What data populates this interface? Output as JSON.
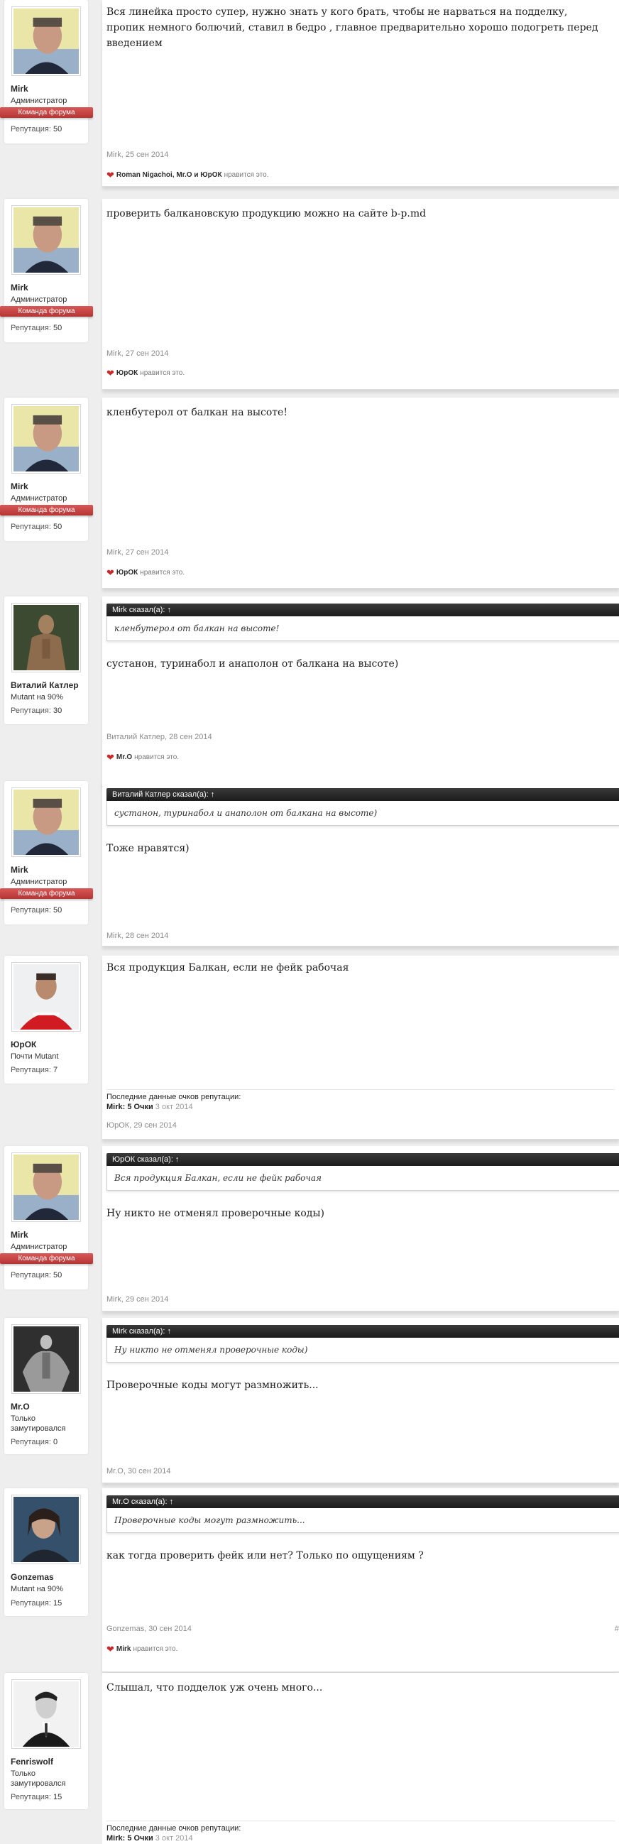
{
  "posts": [
    {
      "user": {
        "name": "Mirk",
        "title": "Администратор",
        "ribbon": "Команда форума",
        "rep_label": "Репутация:",
        "rep_value": "50",
        "avatar": "avatar-mirk"
      },
      "text": "Вся линейка просто супер, нужно знать у кого брать, чтобы не нарваться на подделку, пропик немного болючий, ставил в бедро , главное предварительно хорошо подогреть перед введением",
      "meta": "Mirk, 25 сен 2014",
      "likes": {
        "names": "Roman Nigachoi, Mr.O и ЮрОК",
        "suffix": "нравится это."
      }
    },
    {
      "user": {
        "name": "Mirk",
        "title": "Администратор",
        "ribbon": "Команда форума",
        "rep_label": "Репутация:",
        "rep_value": "50",
        "avatar": "avatar-mirk"
      },
      "text": "проверить балкановскую продукцию можно на сайте b-p.md",
      "meta": "Mirk, 27 сен 2014",
      "likes": {
        "names": "ЮрОК",
        "suffix": "нравится это."
      }
    },
    {
      "user": {
        "name": "Mirk",
        "title": "Администратор",
        "ribbon": "Команда форума",
        "rep_label": "Репутация:",
        "rep_value": "50",
        "avatar": "avatar-mirk"
      },
      "text": "кленбутерол от балкан на высоте!",
      "meta": "Mirk, 27 сен 2014",
      "likes": {
        "names": "ЮрОК",
        "suffix": "нравится это."
      }
    },
    {
      "user": {
        "name": "Виталий Катлер",
        "title": "Mutant на 90%",
        "rep_label": "Репутация:",
        "rep_value": "30",
        "avatar": "avatar-vitaly"
      },
      "quote": {
        "head": "Mirk сказал(а): ↑",
        "body": "кленбутерол от балкан на высоте!"
      },
      "text": "сустанон, туринабол и анаполон от балкана на высоте)",
      "meta": "Виталий Катлер, 28 сен 2014",
      "likes": {
        "names": "Mr.O",
        "suffix": "нравится это."
      }
    },
    {
      "user": {
        "name": "Mirk",
        "title": "Администратор",
        "ribbon": "Команда форума",
        "rep_label": "Репутация:",
        "rep_value": "50",
        "avatar": "avatar-mirk"
      },
      "quote": {
        "head": "Виталий Катлер сказал(а): ↑",
        "body": "сустанон, туринабол и анаполон от балкана на высоте)"
      },
      "text": "Тоже нравятся)",
      "meta": "Mirk, 28 сен 2014"
    },
    {
      "user": {
        "name": "ЮрОК",
        "title": "Почти Mutant",
        "rep_label": "Репутация:",
        "rep_value": "7",
        "avatar": "avatar-yurok"
      },
      "text": "Вся продукция Балкан, если не фейк рабочая",
      "last_rep": {
        "label": "Последние данные очков репутации:",
        "who": "Mirk:",
        "pts": "5 Очки",
        "date": "3 окт 2014"
      },
      "meta": "ЮрОК, 29 сен 2014"
    },
    {
      "user": {
        "name": "Mirk",
        "title": "Администратор",
        "ribbon": "Команда форума",
        "rep_label": "Репутация:",
        "rep_value": "50",
        "avatar": "avatar-mirk"
      },
      "quote": {
        "head": "ЮрОК сказал(а): ↑",
        "body": "Вся продукция Балкан, если не фейк рабочая"
      },
      "text": "Ну никто не отменял проверочные коды)",
      "meta": "Mirk, 29 сен 2014"
    },
    {
      "user": {
        "name": "Mr.O",
        "title": "Только замутировался",
        "rep_label": "Репутация:",
        "rep_value": "0",
        "avatar": "avatar-mro"
      },
      "quote": {
        "head": "Mirk сказал(а): ↑",
        "body": "Ну никто не отменял проверочные коды)"
      },
      "text": "Проверочные коды могут размножить...",
      "meta": "Mr.O, 30 сен 2014"
    },
    {
      "user": {
        "name": "Gonzemas",
        "title": "Mutant на 90%",
        "rep_label": "Репутация:",
        "rep_value": "15",
        "avatar": "avatar-gonzemas"
      },
      "quote": {
        "head": "Mr.O сказал(а): ↑",
        "body": "Проверочные коды могут размножить..."
      },
      "text": "как тогда проверить фейк или нет? Только по ощущениям ?",
      "meta": "Gonzemas, 30 сен 2014",
      "edge": "#",
      "likes": {
        "names": "Mirk",
        "suffix": "нравится это."
      }
    },
    {
      "user": {
        "name": "Fenriswolf",
        "title": "Только замутировался",
        "rep_label": "Репутация:",
        "rep_value": "15",
        "avatar": "avatar-fenriswolf"
      },
      "text": "Слышал, что подделок уж очень много...",
      "last_rep": {
        "label": "Последние данные очков репутации:",
        "who": "Mirk:",
        "pts": "5 Очки",
        "date": "3 окт 2014"
      }
    }
  ]
}
